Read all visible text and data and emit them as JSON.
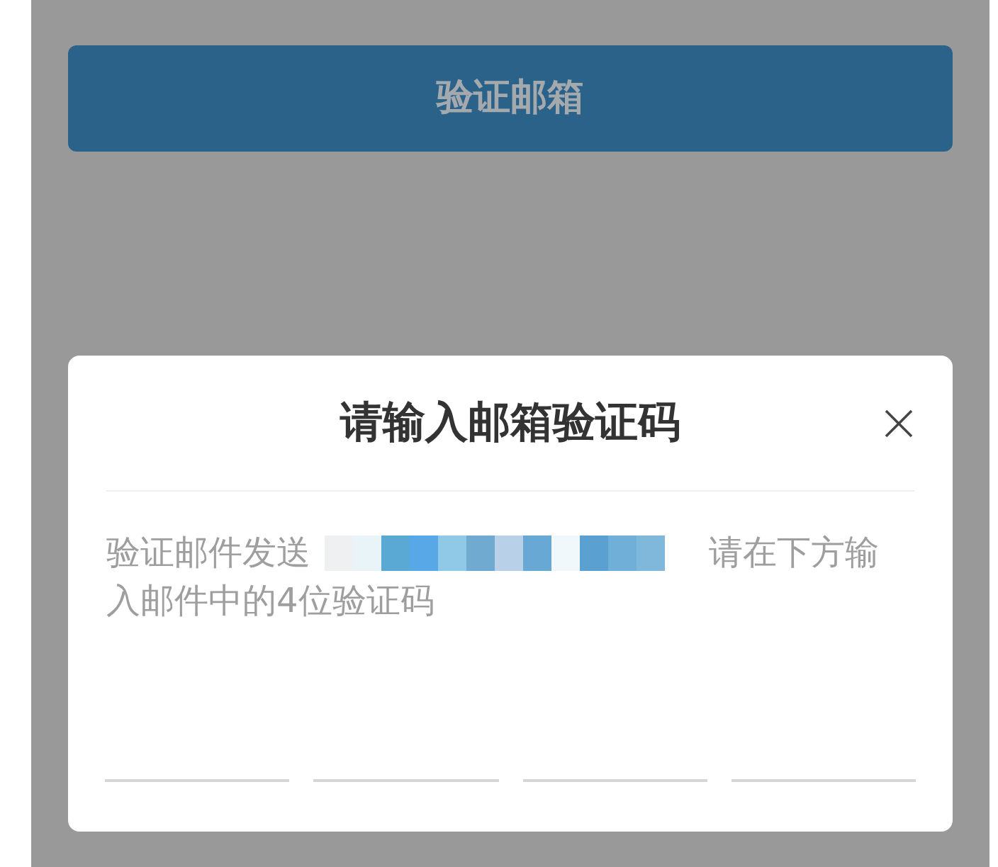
{
  "verify_button": {
    "label": "验证邮箱"
  },
  "dialog": {
    "title": "请输入邮箱验证码",
    "message_lines": [
      [
        {
          "kind": "text",
          "text": "验证邮件发送"
        },
        {
          "kind": "redaction"
        },
        {
          "kind": "text",
          "text": "请在下方输"
        }
      ],
      [
        {
          "kind": "text",
          "text": "入邮件中的4位验证码"
        }
      ]
    ],
    "code_inputs": [
      {
        "kind": "underline"
      },
      {
        "kind": "underline"
      },
      {
        "kind": "underline"
      },
      {
        "kind": "underline"
      }
    ]
  }
}
